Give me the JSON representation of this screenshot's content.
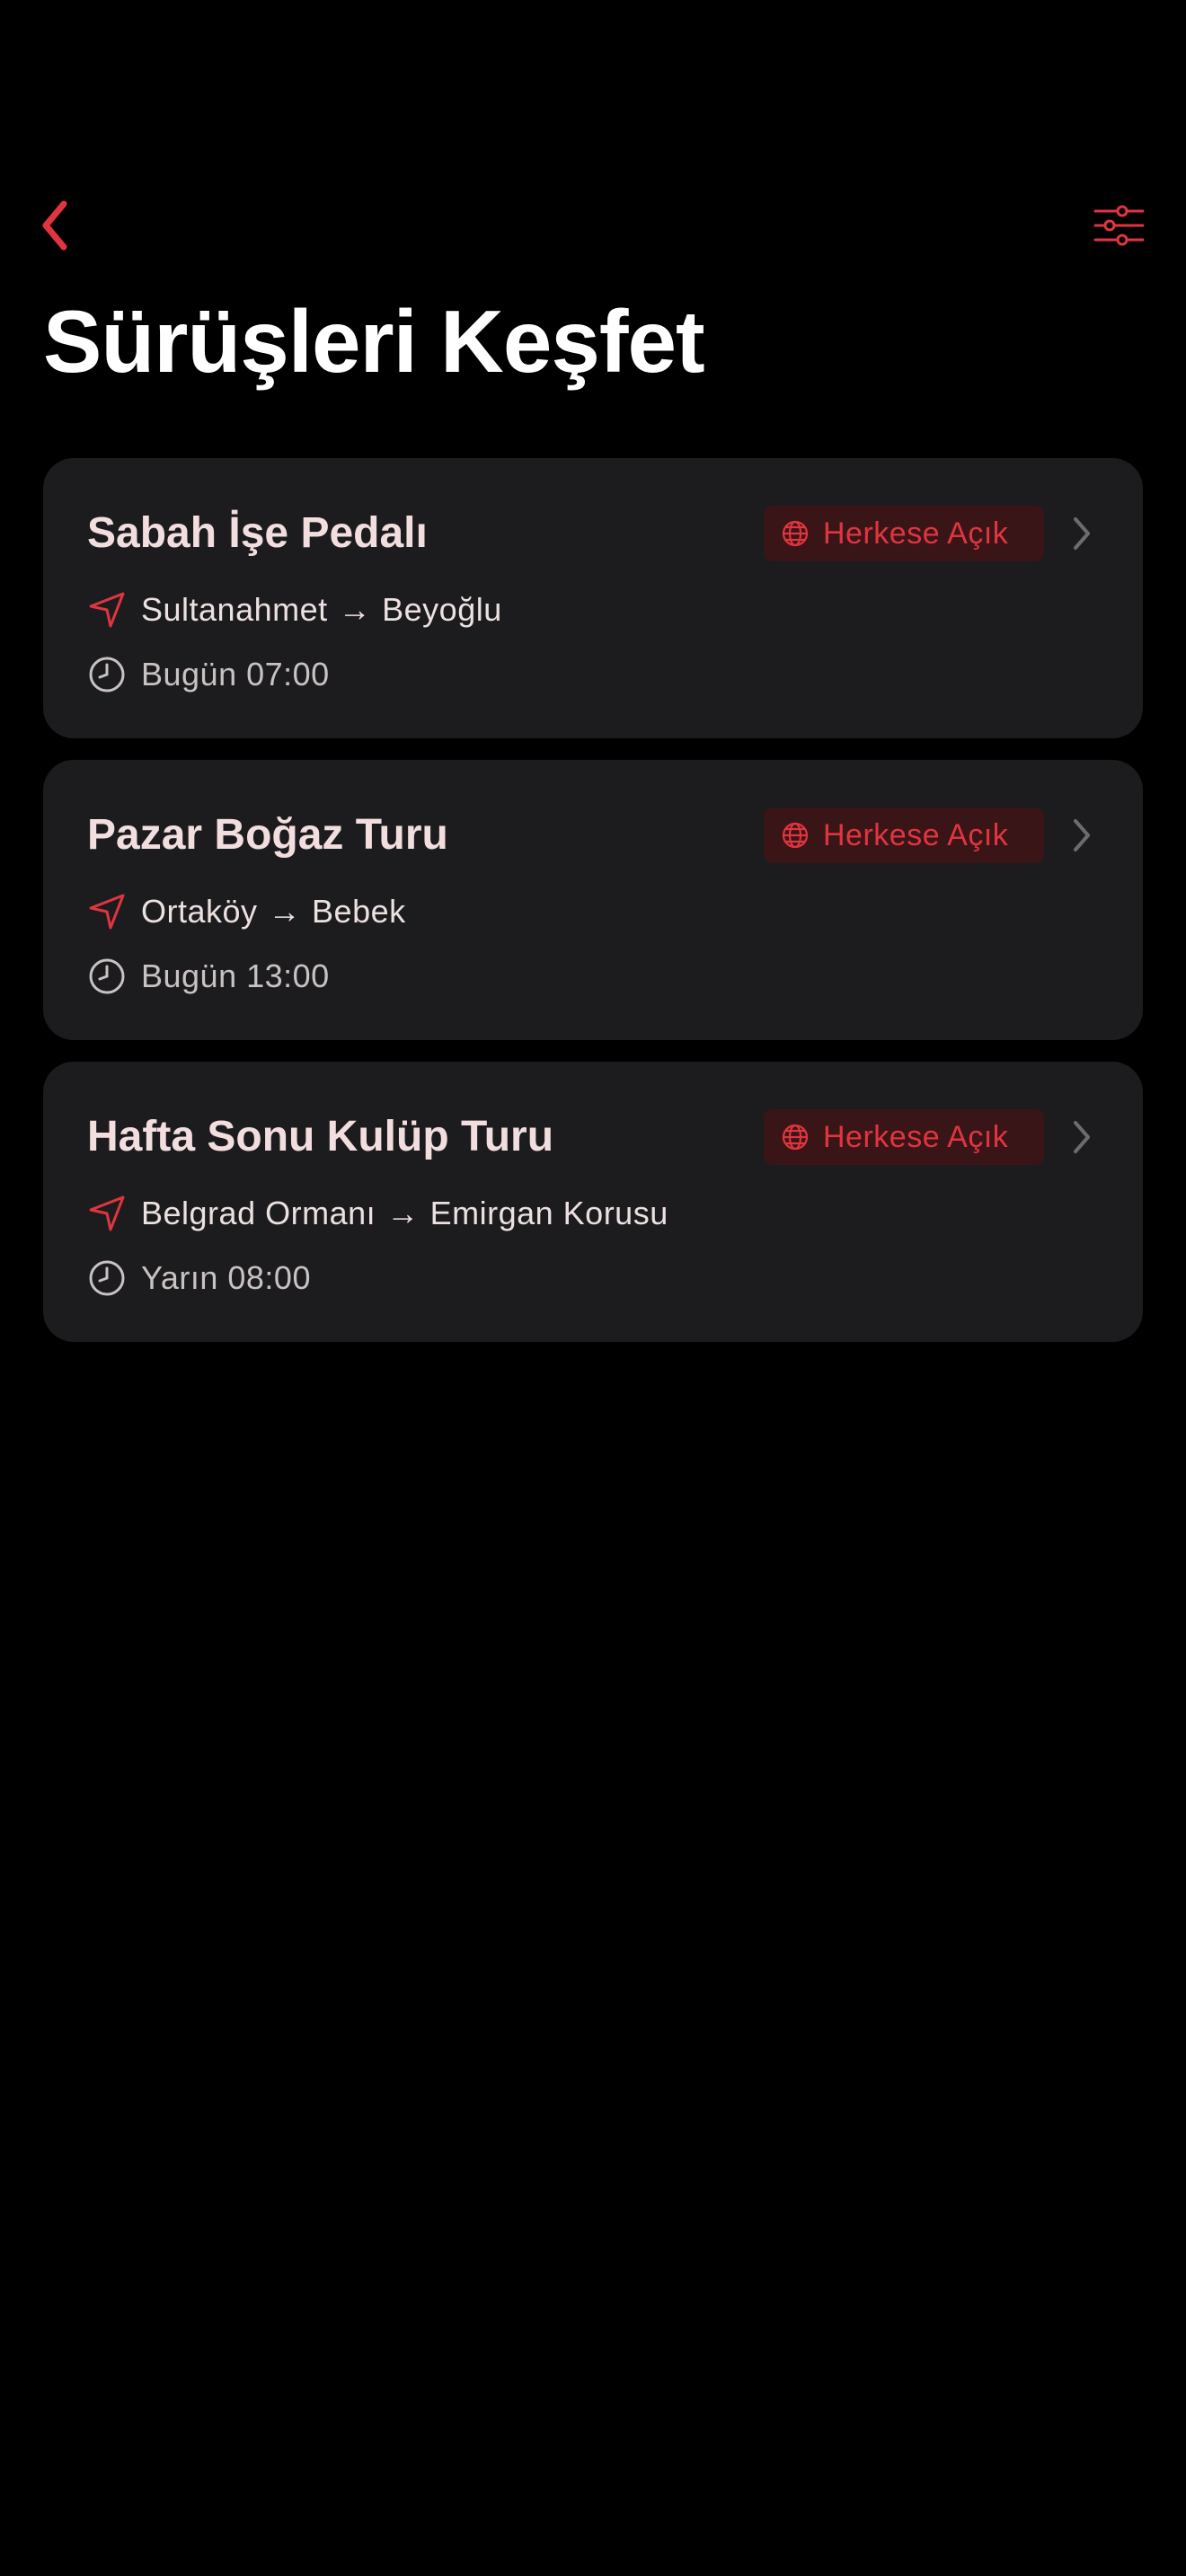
{
  "theme": {
    "accent": "#e0353f",
    "background": "#000000",
    "card": "#1c1c1e",
    "badge_background": "#3a1517"
  },
  "nav": {
    "back_icon": "chevron-left-icon",
    "filter_icon": "sliders-icon"
  },
  "page": {
    "title": "Sürüşleri Keşfet"
  },
  "rides": [
    {
      "title": "Sabah İşe Pedalı",
      "badge": "Herkese Açık",
      "badge_icon": "globe-icon",
      "from": "Sultanahmet",
      "arrow": "→",
      "to": "Beyoğlu",
      "time": "Bugün 07:00"
    },
    {
      "title": "Pazar Boğaz Turu",
      "badge": "Herkese Açık",
      "badge_icon": "globe-icon",
      "from": "Ortaköy",
      "arrow": "→",
      "to": "Bebek",
      "time": "Bugün 13:00"
    },
    {
      "title": "Hafta Sonu Kulüp Turu",
      "badge": "Herkese Açık",
      "badge_icon": "globe-icon",
      "from": "Belgrad Ormanı",
      "arrow": "→",
      "to": "Emirgan Korusu",
      "time": "Yarın 08:00"
    }
  ]
}
